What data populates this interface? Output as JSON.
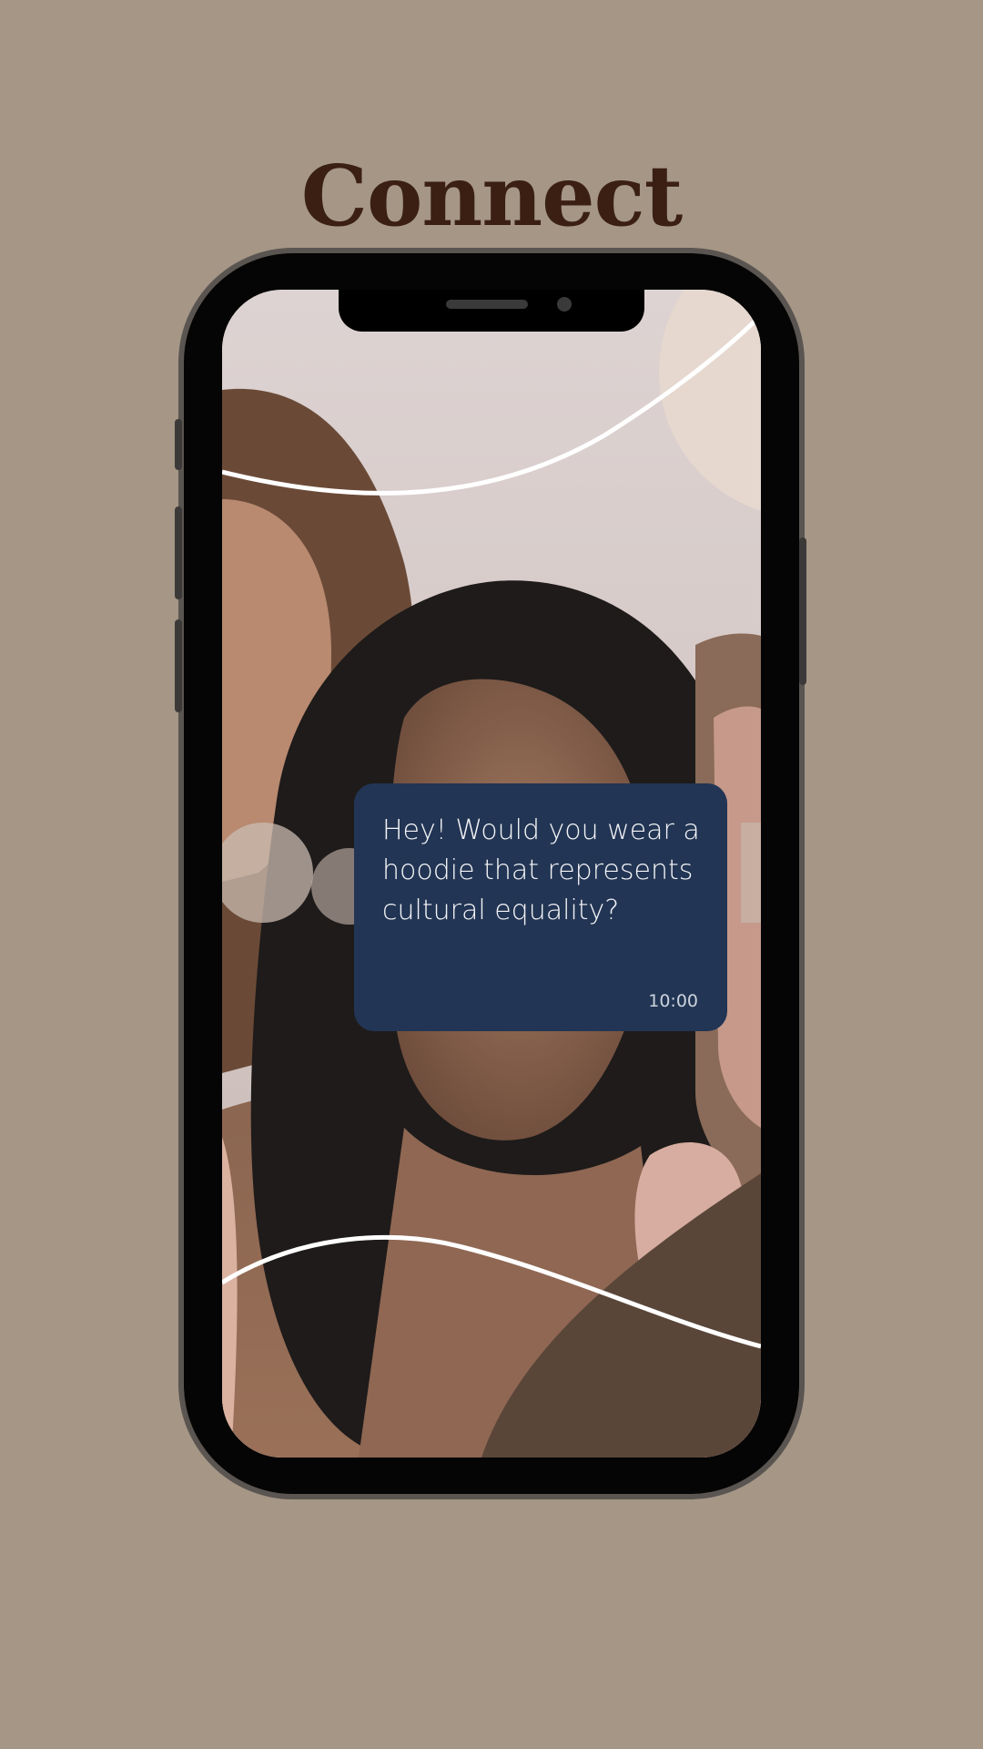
{
  "brand": {
    "logo_text": "Connect",
    "logo_color": "#3a1f12",
    "background_color": "#a59686"
  },
  "message": {
    "text": "Hey! Would you wear a hoodie that represents cultural equality?",
    "time": "10:00",
    "bubble_color": "#223554"
  }
}
